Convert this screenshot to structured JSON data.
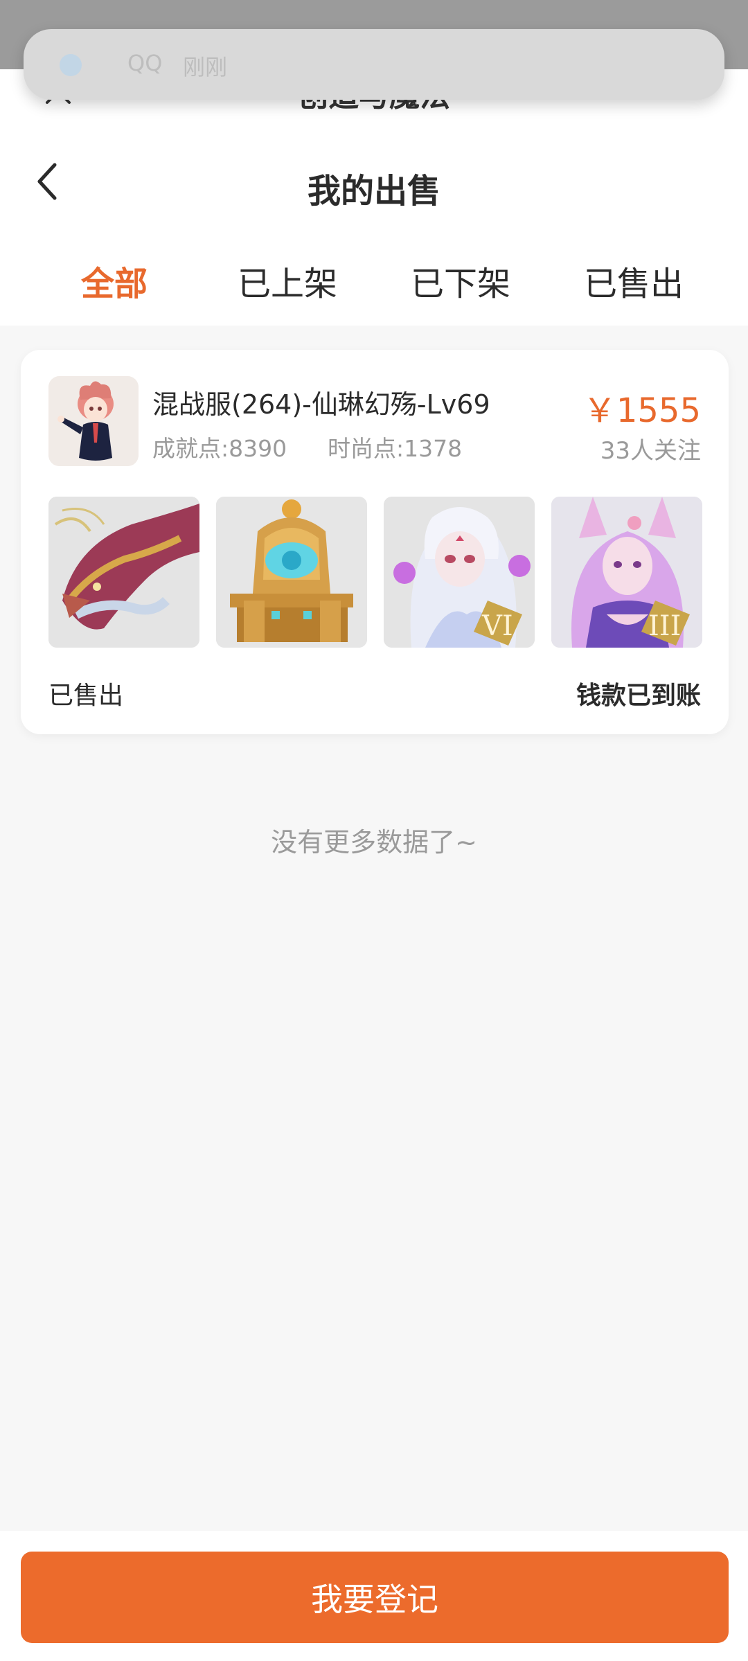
{
  "notification": {
    "app": "QQ",
    "time": "刚刚"
  },
  "webview": {
    "title": "创造与魔法"
  },
  "header": {
    "title": "我的出售",
    "tabs": [
      {
        "label": "全部",
        "active": true
      },
      {
        "label": "已上架",
        "active": false
      },
      {
        "label": "已下架",
        "active": false
      },
      {
        "label": "已售出",
        "active": false
      }
    ]
  },
  "listing": {
    "title": "混战服(264)-仙琳幻殇-Lv69",
    "achievement": "成就点:8390",
    "fashion": "时尚点:1378",
    "price": "￥1555",
    "followers": "33人关注",
    "status": "已售出",
    "payment_status": "钱款已到账",
    "thumbnails": [
      {
        "icon": "dragon-mount-image"
      },
      {
        "icon": "golden-throne-image"
      },
      {
        "icon": "white-character-image",
        "badge": "VI"
      },
      {
        "icon": "pink-fox-character-image",
        "badge": "III"
      }
    ]
  },
  "footer_note": "没有更多数据了~",
  "bottom_button": "我要登记",
  "colors": {
    "accent": "#e8692d",
    "button": "#ec6b2c"
  }
}
